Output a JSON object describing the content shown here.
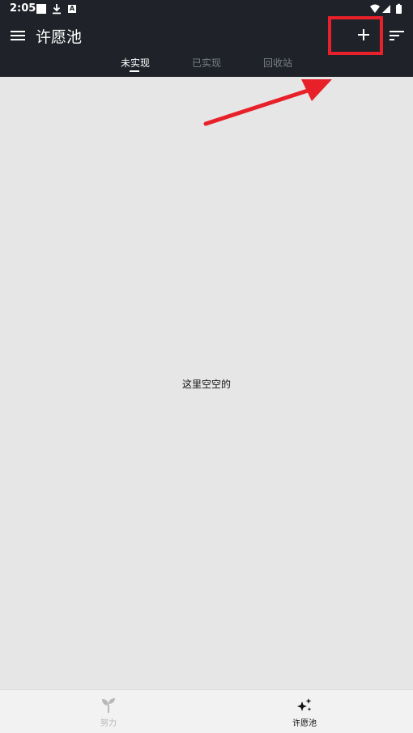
{
  "status_bar": {
    "time": "2:05",
    "icons": [
      "notification-square-icon",
      "download-icon",
      "a-badge-icon",
      "wifi-icon",
      "signal-icon",
      "battery-icon"
    ]
  },
  "app_bar": {
    "title": "许愿池",
    "menu_icon": "hamburger-menu-icon",
    "add_icon": "plus-icon",
    "sort_icon": "sort-icon"
  },
  "tabs": [
    {
      "label": "未实现",
      "active": true
    },
    {
      "label": "已实现",
      "active": false
    },
    {
      "label": "回收站",
      "active": false
    }
  ],
  "main": {
    "empty_message": "这里空空的"
  },
  "bottom_nav": [
    {
      "label": "努力",
      "icon": "sprout-icon",
      "active": false
    },
    {
      "label": "许愿池",
      "icon": "sparkles-icon",
      "active": true
    }
  ],
  "annotation": {
    "highlight_color": "#e8202a"
  },
  "colors": {
    "app_bar_bg": "#1f2329",
    "content_bg": "#e6e6e6",
    "bottom_nav_bg": "#f2f2f2",
    "tab_inactive": "#7a7f86"
  }
}
